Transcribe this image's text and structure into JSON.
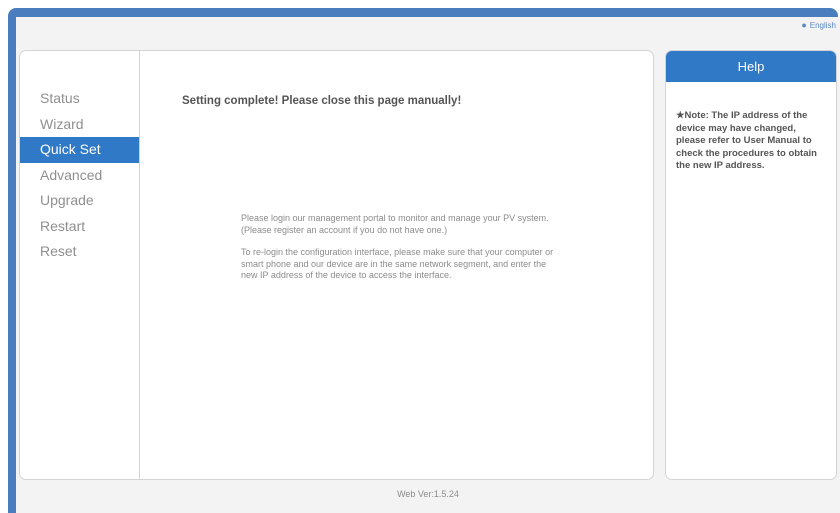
{
  "header": {
    "language_label": "English"
  },
  "sidebar": {
    "items": [
      {
        "label": "Status"
      },
      {
        "label": "Wizard"
      },
      {
        "label": "Quick Set"
      },
      {
        "label": "Advanced"
      },
      {
        "label": "Upgrade"
      },
      {
        "label": "Restart"
      },
      {
        "label": "Reset"
      }
    ],
    "active": "Quick Set"
  },
  "main": {
    "title": "Setting complete! Please close this page manually!",
    "paragraphs": [
      "Please login our management portal to monitor and manage your PV system.(Please register an account if you do not have one.)",
      "To re-login the configuration interface, please make sure that your computer or smart phone and our device are in the same network segment, and enter the new IP address of the device to access the interface."
    ]
  },
  "help": {
    "title": "Help",
    "note": "★Note: The IP address of the device may have changed, please refer to User Manual to check the procedures to obtain the new IP address."
  },
  "footer": {
    "version": "Web Ver:1.5.24"
  },
  "colors": {
    "accent": "#2f79c6",
    "frame": "#4a7dbd",
    "background": "#f3f3f3"
  }
}
